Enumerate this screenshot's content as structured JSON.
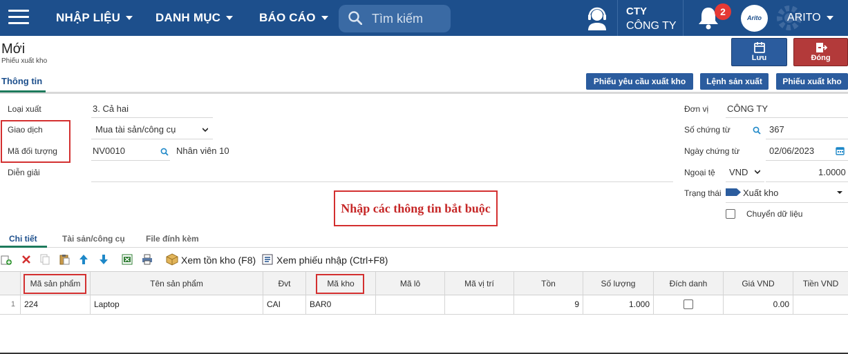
{
  "nav": {
    "items": [
      "NHẬP LIỆU",
      "DANH MỤC",
      "BÁO CÁO"
    ],
    "search_placeholder": "Tìm kiếm",
    "company_short": "CTY",
    "company_name": "CÔNG TY",
    "notification_count": "2",
    "avatar_text": "Arito",
    "user_name": "ARITO",
    "brand_color": "#1d4f8c"
  },
  "page": {
    "title": "Mới",
    "subtitle": "Phiếu xuất kho",
    "save_label": "Lưu",
    "close_label": "Đóng",
    "tab_info": "Thông tin",
    "actions": [
      "Phiếu yêu cầu xuất kho",
      "Lệnh sản xuất",
      "Phiếu xuất kho"
    ]
  },
  "form": {
    "left": {
      "loai_xuat_label": "Loại xuất",
      "loai_xuat_value": "3. Cả hai",
      "giao_dich_label": "Giao dịch",
      "giao_dich_value": "Mua tài sản/công cụ",
      "ma_doi_tuong_label": "Mã đối tượng",
      "ma_doi_tuong_value": "NV0010",
      "ten_doi_tuong": "Nhân viên 10",
      "dien_giai_label": "Diễn giải",
      "dien_giai_value": ""
    },
    "right": {
      "don_vi_label": "Đơn vị",
      "don_vi_value": "CÔNG TY",
      "so_chung_tu_label": "Số chứng từ",
      "so_chung_tu_value": "367",
      "ngay_chung_tu_label": "Ngày chứng từ",
      "ngay_chung_tu_value": "02/06/2023",
      "ngoai_te_label": "Ngoại tệ",
      "ngoai_te_value": "VND",
      "ty_gia_value": "1.0000",
      "trang_thai_label": "Trạng thái",
      "trang_thai_value": "Xuất kho",
      "chuyen_du_lieu_label": "Chuyển dữ liệu"
    },
    "note": "Nhập các thông tin bắt buộc"
  },
  "detail": {
    "tabs": [
      "Chi tiết",
      "Tài sản/công cụ",
      "File đính kèm"
    ],
    "toolbar": {
      "xem_ton_kho": "Xem tồn kho (F8)",
      "xem_phieu_nhap": "Xem phiếu nhập (Ctrl+F8)"
    },
    "columns": [
      "Mã sản phẩm",
      "Tên sản phẩm",
      "Đvt",
      "Mã kho",
      "Mã lô",
      "Mã vị trí",
      "Tồn",
      "Số lượng",
      "Đích danh",
      "Giá VND",
      "Tiền VND"
    ],
    "rows": [
      {
        "stt": "1",
        "ma_san_pham": "224",
        "ten_san_pham": "Laptop",
        "dvt": "CAI",
        "ma_kho": "BAR0",
        "ma_lo": "",
        "ma_vi_tri": "",
        "ton": "9",
        "so_luong": "1.000",
        "gia_vnd": "0.00",
        "tien_vnd": ""
      }
    ]
  }
}
